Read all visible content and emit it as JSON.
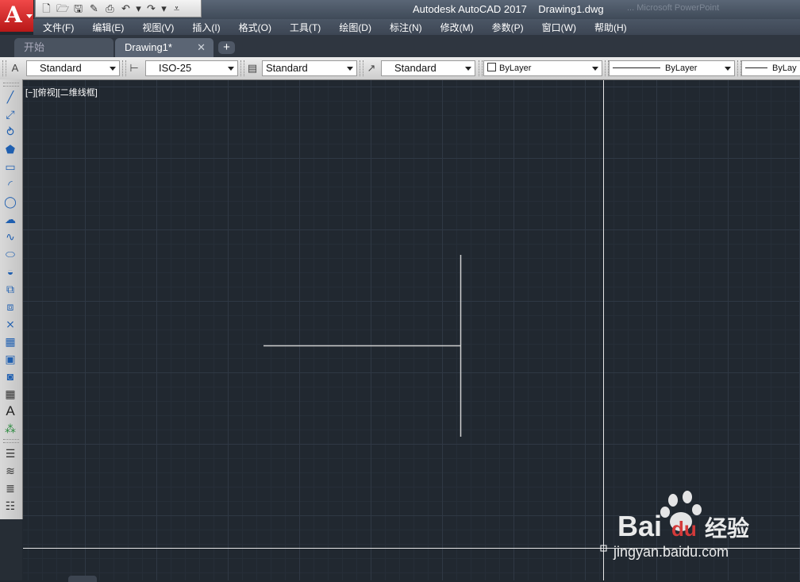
{
  "window": {
    "title": "Autodesk AutoCAD 2017    Drawing1.dwg",
    "ghost_text": "...  Microsoft PowerPoint"
  },
  "app_logo": {
    "letter": "A"
  },
  "quick_access": {
    "icons": [
      "new-icon",
      "open-icon",
      "save-icon",
      "save-as-icon",
      "print-icon",
      "undo-icon",
      "undo-dropdown-icon",
      "redo-icon",
      "redo-dropdown-icon",
      "customize-icon"
    ],
    "glyphs": [
      "🗋",
      "🗁",
      "🖫",
      "✎",
      "⎙",
      "↶",
      "▾",
      "↷",
      "▾",
      "⩡"
    ]
  },
  "menu": [
    "文件(F)",
    "编辑(E)",
    "视图(V)",
    "插入(I)",
    "格式(O)",
    "工具(T)",
    "绘图(D)",
    "标注(N)",
    "修改(M)",
    "参数(P)",
    "窗口(W)",
    "帮助(H)"
  ],
  "tabs": {
    "start": "开始",
    "drawing": "Drawing1*",
    "close": "✕",
    "new": "+"
  },
  "styles_toolbar": {
    "text_style": "Standard",
    "dim_style": "ISO-25",
    "table_style": "Standard",
    "mleader_style": "Standard",
    "color": "ByLayer",
    "linetype": "ByLayer",
    "lineweight": "ByLay"
  },
  "draw_toolbar": {
    "tools": [
      {
        "name": "line-icon",
        "glyph": "╱"
      },
      {
        "name": "construction-line-icon",
        "glyph": "⤢"
      },
      {
        "name": "polyline-icon",
        "glyph": "⥁"
      },
      {
        "name": "polygon-icon",
        "glyph": "⬟"
      },
      {
        "name": "rectangle-icon",
        "glyph": "▭"
      },
      {
        "name": "arc-icon",
        "glyph": "◜"
      },
      {
        "name": "circle-icon",
        "glyph": "◯"
      },
      {
        "name": "revision-cloud-icon",
        "glyph": "☁"
      },
      {
        "name": "spline-icon",
        "glyph": "∿"
      },
      {
        "name": "ellipse-icon",
        "glyph": "⬭"
      },
      {
        "name": "ellipse-arc-icon",
        "glyph": "◒"
      },
      {
        "name": "insert-block-icon",
        "glyph": "⧉"
      },
      {
        "name": "make-block-icon",
        "glyph": "⧈"
      },
      {
        "name": "point-icon",
        "glyph": "⨯"
      },
      {
        "name": "hatch-icon",
        "glyph": "▦"
      },
      {
        "name": "gradient-icon",
        "glyph": "▣"
      },
      {
        "name": "region-icon",
        "glyph": "◙"
      },
      {
        "name": "table-icon",
        "glyph": "▦"
      },
      {
        "name": "multiline-text-icon",
        "glyph": "A"
      },
      {
        "name": "add-selected-icon",
        "glyph": "⁂"
      }
    ],
    "tools2": [
      {
        "name": "layer-properties-icon",
        "glyph": "☰"
      },
      {
        "name": "layer-states-icon",
        "glyph": "≋"
      },
      {
        "name": "layer-previous-icon",
        "glyph": "≣"
      },
      {
        "name": "layer-match-icon",
        "glyph": "☷"
      }
    ]
  },
  "viewport": {
    "label": "[−][俯视][二维线框]"
  },
  "colors": {
    "canvas": "#212830",
    "crosshair": "#e6e6e6",
    "geometry": "#cfcfcf",
    "logo_red": "#d42b2b"
  },
  "watermark": {
    "brand": "Bai",
    "brand2": "du",
    "cn": "经验",
    "url": "jingyan.baidu.com"
  }
}
